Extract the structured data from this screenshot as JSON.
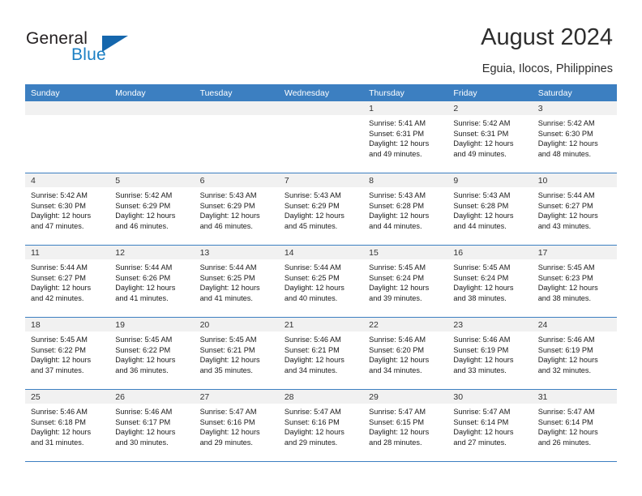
{
  "brand": {
    "name_part1": "General",
    "name_part2": "Blue"
  },
  "header": {
    "title": "August 2024",
    "subtitle": "Eguia, Ilocos, Philippines"
  },
  "colors": {
    "header_blue": "#3c7fc1",
    "brand_blue": "#1b7fc4",
    "date_band": "#f1f1f1"
  },
  "weekday_headers": [
    "Sunday",
    "Monday",
    "Tuesday",
    "Wednesday",
    "Thursday",
    "Friday",
    "Saturday"
  ],
  "weeks": [
    [
      {
        "day": "",
        "sunrise": "",
        "sunset": "",
        "daylight1": "",
        "daylight2": ""
      },
      {
        "day": "",
        "sunrise": "",
        "sunset": "",
        "daylight1": "",
        "daylight2": ""
      },
      {
        "day": "",
        "sunrise": "",
        "sunset": "",
        "daylight1": "",
        "daylight2": ""
      },
      {
        "day": "",
        "sunrise": "",
        "sunset": "",
        "daylight1": "",
        "daylight2": ""
      },
      {
        "day": "1",
        "sunrise": "Sunrise: 5:41 AM",
        "sunset": "Sunset: 6:31 PM",
        "daylight1": "Daylight: 12 hours",
        "daylight2": "and 49 minutes."
      },
      {
        "day": "2",
        "sunrise": "Sunrise: 5:42 AM",
        "sunset": "Sunset: 6:31 PM",
        "daylight1": "Daylight: 12 hours",
        "daylight2": "and 49 minutes."
      },
      {
        "day": "3",
        "sunrise": "Sunrise: 5:42 AM",
        "sunset": "Sunset: 6:30 PM",
        "daylight1": "Daylight: 12 hours",
        "daylight2": "and 48 minutes."
      }
    ],
    [
      {
        "day": "4",
        "sunrise": "Sunrise: 5:42 AM",
        "sunset": "Sunset: 6:30 PM",
        "daylight1": "Daylight: 12 hours",
        "daylight2": "and 47 minutes."
      },
      {
        "day": "5",
        "sunrise": "Sunrise: 5:42 AM",
        "sunset": "Sunset: 6:29 PM",
        "daylight1": "Daylight: 12 hours",
        "daylight2": "and 46 minutes."
      },
      {
        "day": "6",
        "sunrise": "Sunrise: 5:43 AM",
        "sunset": "Sunset: 6:29 PM",
        "daylight1": "Daylight: 12 hours",
        "daylight2": "and 46 minutes."
      },
      {
        "day": "7",
        "sunrise": "Sunrise: 5:43 AM",
        "sunset": "Sunset: 6:29 PM",
        "daylight1": "Daylight: 12 hours",
        "daylight2": "and 45 minutes."
      },
      {
        "day": "8",
        "sunrise": "Sunrise: 5:43 AM",
        "sunset": "Sunset: 6:28 PM",
        "daylight1": "Daylight: 12 hours",
        "daylight2": "and 44 minutes."
      },
      {
        "day": "9",
        "sunrise": "Sunrise: 5:43 AM",
        "sunset": "Sunset: 6:28 PM",
        "daylight1": "Daylight: 12 hours",
        "daylight2": "and 44 minutes."
      },
      {
        "day": "10",
        "sunrise": "Sunrise: 5:44 AM",
        "sunset": "Sunset: 6:27 PM",
        "daylight1": "Daylight: 12 hours",
        "daylight2": "and 43 minutes."
      }
    ],
    [
      {
        "day": "11",
        "sunrise": "Sunrise: 5:44 AM",
        "sunset": "Sunset: 6:27 PM",
        "daylight1": "Daylight: 12 hours",
        "daylight2": "and 42 minutes."
      },
      {
        "day": "12",
        "sunrise": "Sunrise: 5:44 AM",
        "sunset": "Sunset: 6:26 PM",
        "daylight1": "Daylight: 12 hours",
        "daylight2": "and 41 minutes."
      },
      {
        "day": "13",
        "sunrise": "Sunrise: 5:44 AM",
        "sunset": "Sunset: 6:25 PM",
        "daylight1": "Daylight: 12 hours",
        "daylight2": "and 41 minutes."
      },
      {
        "day": "14",
        "sunrise": "Sunrise: 5:44 AM",
        "sunset": "Sunset: 6:25 PM",
        "daylight1": "Daylight: 12 hours",
        "daylight2": "and 40 minutes."
      },
      {
        "day": "15",
        "sunrise": "Sunrise: 5:45 AM",
        "sunset": "Sunset: 6:24 PM",
        "daylight1": "Daylight: 12 hours",
        "daylight2": "and 39 minutes."
      },
      {
        "day": "16",
        "sunrise": "Sunrise: 5:45 AM",
        "sunset": "Sunset: 6:24 PM",
        "daylight1": "Daylight: 12 hours",
        "daylight2": "and 38 minutes."
      },
      {
        "day": "17",
        "sunrise": "Sunrise: 5:45 AM",
        "sunset": "Sunset: 6:23 PM",
        "daylight1": "Daylight: 12 hours",
        "daylight2": "and 38 minutes."
      }
    ],
    [
      {
        "day": "18",
        "sunrise": "Sunrise: 5:45 AM",
        "sunset": "Sunset: 6:22 PM",
        "daylight1": "Daylight: 12 hours",
        "daylight2": "and 37 minutes."
      },
      {
        "day": "19",
        "sunrise": "Sunrise: 5:45 AM",
        "sunset": "Sunset: 6:22 PM",
        "daylight1": "Daylight: 12 hours",
        "daylight2": "and 36 minutes."
      },
      {
        "day": "20",
        "sunrise": "Sunrise: 5:45 AM",
        "sunset": "Sunset: 6:21 PM",
        "daylight1": "Daylight: 12 hours",
        "daylight2": "and 35 minutes."
      },
      {
        "day": "21",
        "sunrise": "Sunrise: 5:46 AM",
        "sunset": "Sunset: 6:21 PM",
        "daylight1": "Daylight: 12 hours",
        "daylight2": "and 34 minutes."
      },
      {
        "day": "22",
        "sunrise": "Sunrise: 5:46 AM",
        "sunset": "Sunset: 6:20 PM",
        "daylight1": "Daylight: 12 hours",
        "daylight2": "and 34 minutes."
      },
      {
        "day": "23",
        "sunrise": "Sunrise: 5:46 AM",
        "sunset": "Sunset: 6:19 PM",
        "daylight1": "Daylight: 12 hours",
        "daylight2": "and 33 minutes."
      },
      {
        "day": "24",
        "sunrise": "Sunrise: 5:46 AM",
        "sunset": "Sunset: 6:19 PM",
        "daylight1": "Daylight: 12 hours",
        "daylight2": "and 32 minutes."
      }
    ],
    [
      {
        "day": "25",
        "sunrise": "Sunrise: 5:46 AM",
        "sunset": "Sunset: 6:18 PM",
        "daylight1": "Daylight: 12 hours",
        "daylight2": "and 31 minutes."
      },
      {
        "day": "26",
        "sunrise": "Sunrise: 5:46 AM",
        "sunset": "Sunset: 6:17 PM",
        "daylight1": "Daylight: 12 hours",
        "daylight2": "and 30 minutes."
      },
      {
        "day": "27",
        "sunrise": "Sunrise: 5:47 AM",
        "sunset": "Sunset: 6:16 PM",
        "daylight1": "Daylight: 12 hours",
        "daylight2": "and 29 minutes."
      },
      {
        "day": "28",
        "sunrise": "Sunrise: 5:47 AM",
        "sunset": "Sunset: 6:16 PM",
        "daylight1": "Daylight: 12 hours",
        "daylight2": "and 29 minutes."
      },
      {
        "day": "29",
        "sunrise": "Sunrise: 5:47 AM",
        "sunset": "Sunset: 6:15 PM",
        "daylight1": "Daylight: 12 hours",
        "daylight2": "and 28 minutes."
      },
      {
        "day": "30",
        "sunrise": "Sunrise: 5:47 AM",
        "sunset": "Sunset: 6:14 PM",
        "daylight1": "Daylight: 12 hours",
        "daylight2": "and 27 minutes."
      },
      {
        "day": "31",
        "sunrise": "Sunrise: 5:47 AM",
        "sunset": "Sunset: 6:14 PM",
        "daylight1": "Daylight: 12 hours",
        "daylight2": "and 26 minutes."
      }
    ]
  ]
}
